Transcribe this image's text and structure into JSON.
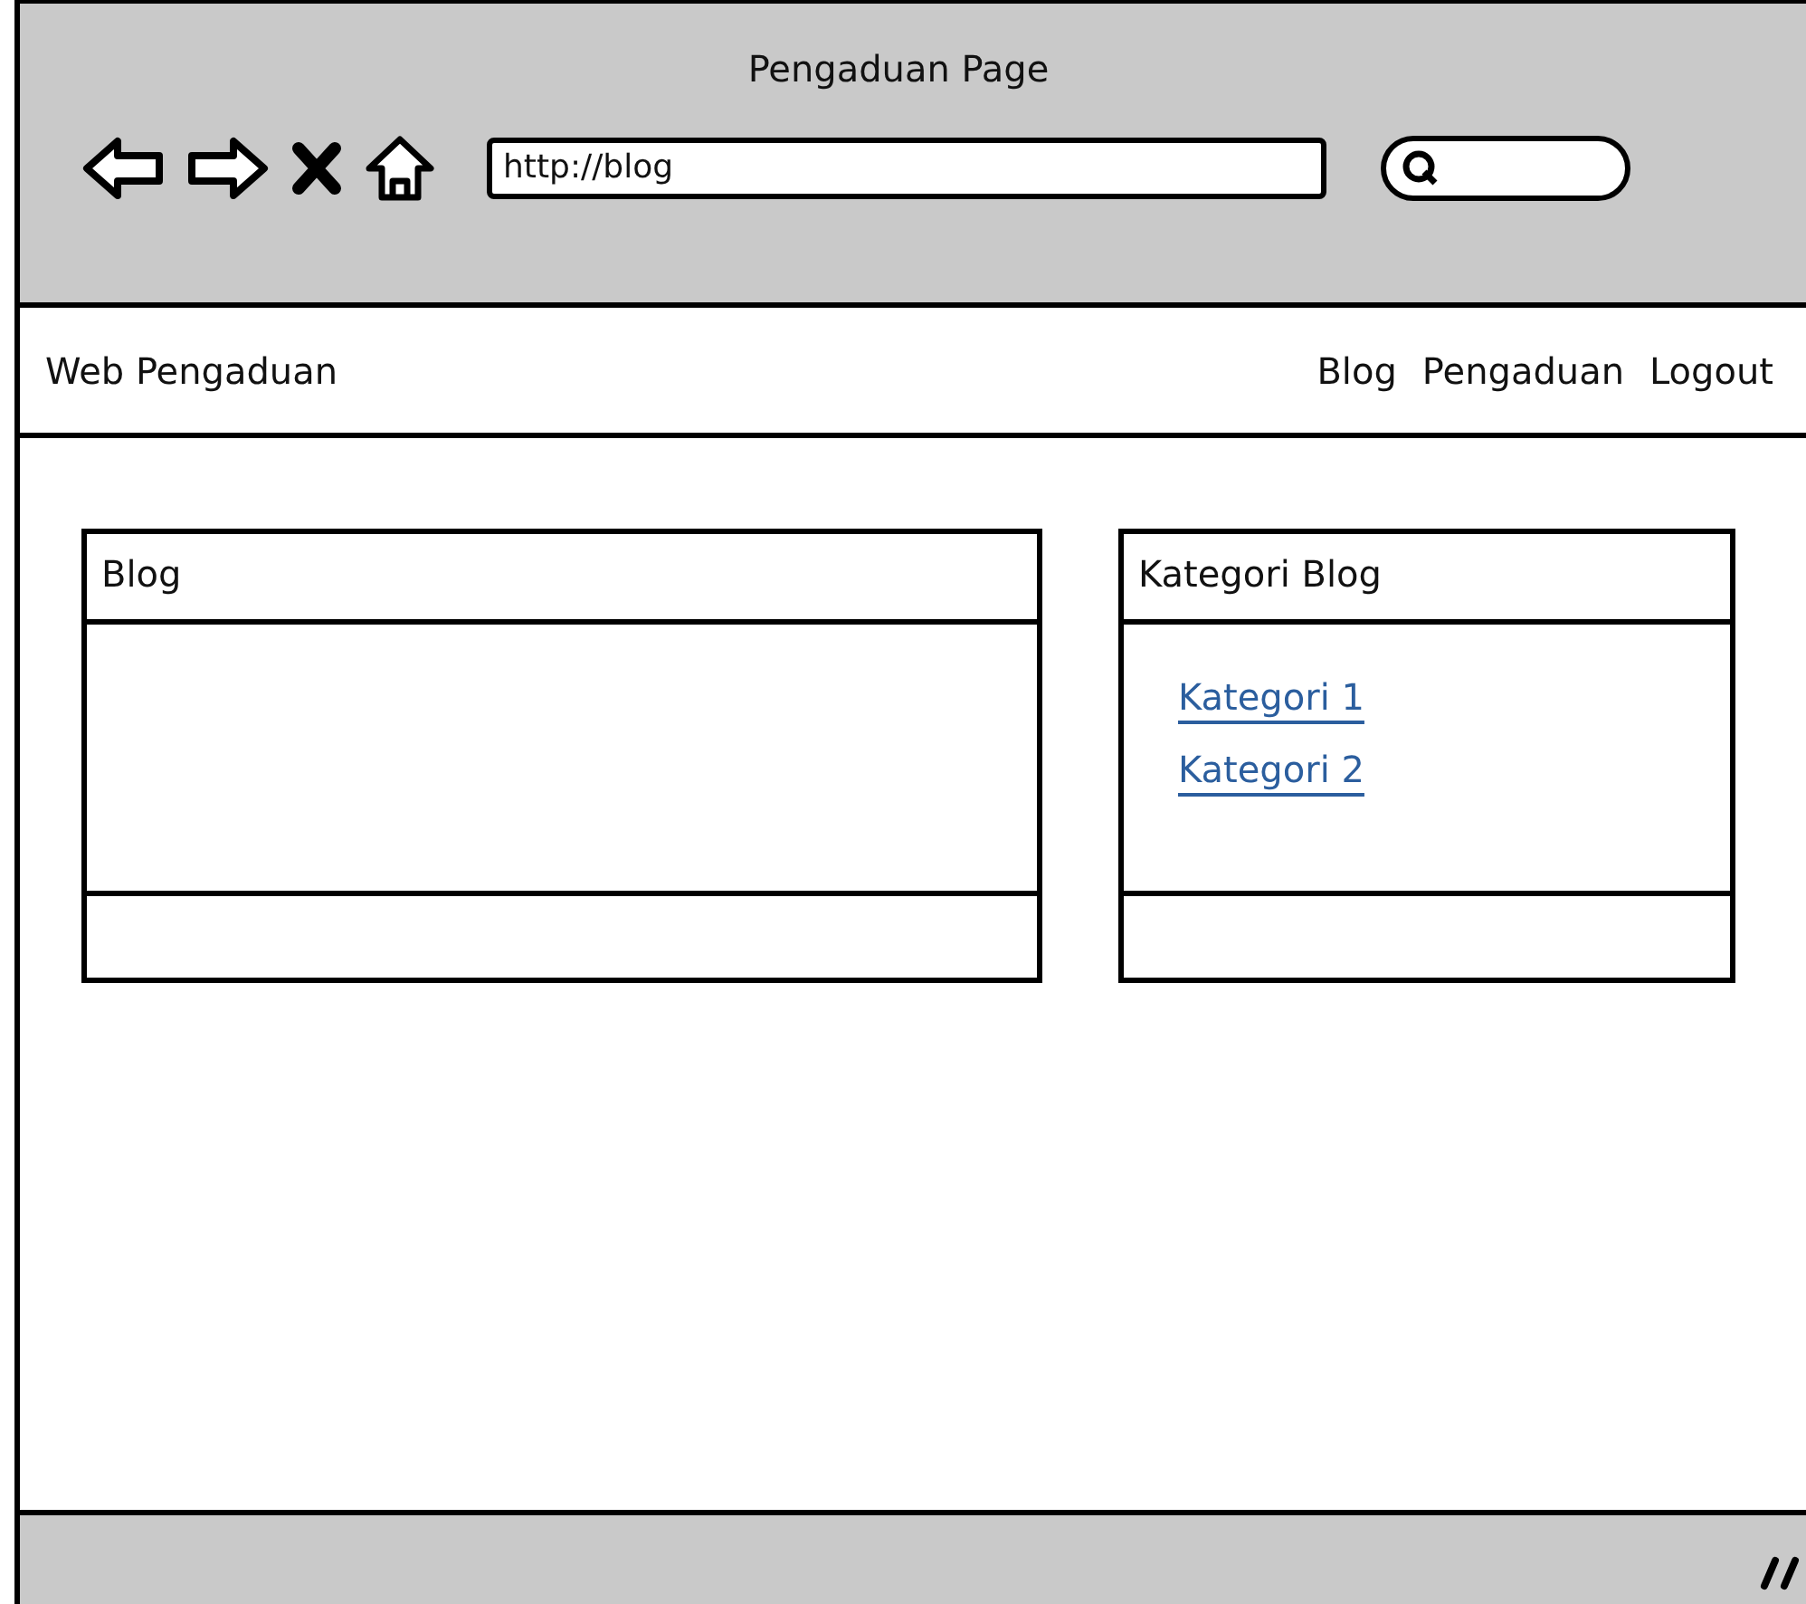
{
  "window": {
    "title": "Pengaduan Page"
  },
  "address_bar": {
    "value": "http://blog"
  },
  "navbar": {
    "brand": "Web Pengaduan",
    "links": [
      "Blog",
      "Pengaduan",
      "Logout"
    ]
  },
  "panels": [
    {
      "title": "Blog"
    },
    {
      "title": "Kategori Blog",
      "links": [
        "Kategori 1",
        "Kategori 2"
      ]
    }
  ]
}
